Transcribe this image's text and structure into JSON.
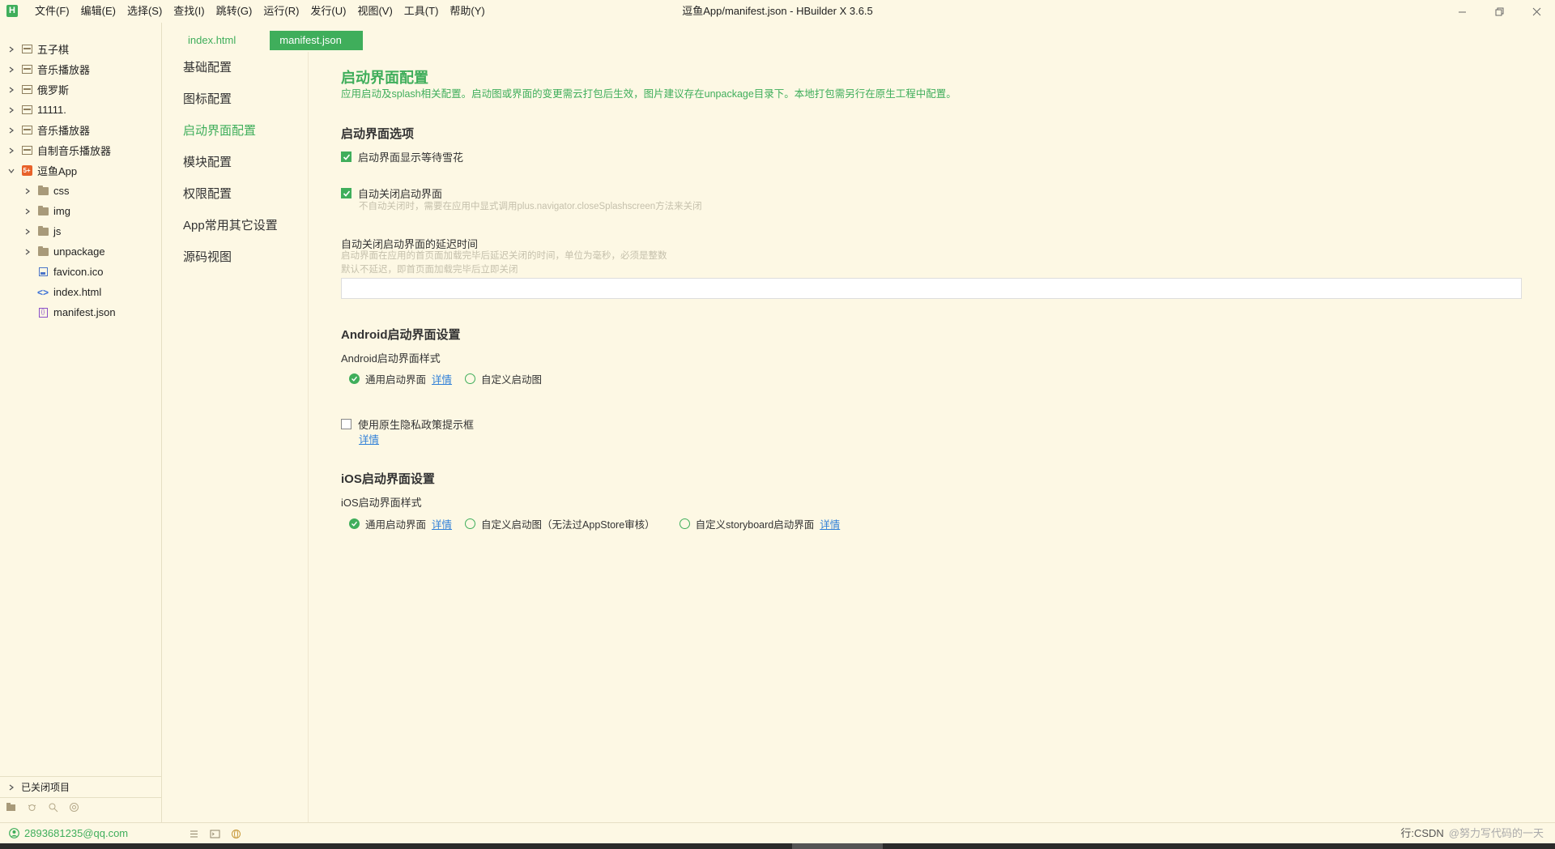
{
  "app": {
    "logo": "H",
    "title": "逗鱼App/manifest.json - HBuilder X 3.6.5",
    "menu": [
      "文件(F)",
      "编辑(E)",
      "选择(S)",
      "查找(I)",
      "跳转(G)",
      "运行(R)",
      "发行(U)",
      "视图(V)",
      "工具(T)",
      "帮助(Y)"
    ]
  },
  "tree": {
    "items": [
      {
        "label": "五子棋",
        "type": "project",
        "expanded": false,
        "level": 0
      },
      {
        "label": "音乐播放器",
        "type": "project",
        "expanded": false,
        "level": 0
      },
      {
        "label": "俄罗斯",
        "type": "project",
        "expanded": false,
        "level": 0
      },
      {
        "label": "11111.",
        "type": "project",
        "expanded": false,
        "level": 0
      },
      {
        "label": "音乐播放器",
        "type": "project",
        "expanded": false,
        "level": 0
      },
      {
        "label": "自制音乐播放器",
        "type": "project",
        "expanded": false,
        "level": 0
      },
      {
        "label": "逗鱼App",
        "type": "uniapp",
        "expanded": true,
        "level": 0
      },
      {
        "label": "css",
        "type": "folder",
        "expanded": false,
        "level": 1
      },
      {
        "label": "img",
        "type": "folder",
        "expanded": false,
        "level": 1
      },
      {
        "label": "js",
        "type": "folder",
        "expanded": false,
        "level": 1
      },
      {
        "label": "unpackage",
        "type": "folder",
        "expanded": false,
        "level": 1
      },
      {
        "label": "favicon.ico",
        "type": "ico",
        "level": 1
      },
      {
        "label": "index.html",
        "type": "html",
        "level": 1
      },
      {
        "label": "manifest.json",
        "type": "json",
        "level": 1
      }
    ],
    "closed_projects": "已关闭项目"
  },
  "tabs": [
    "index.html",
    "manifest.json"
  ],
  "nav": [
    "基础配置",
    "图标配置",
    "启动界面配置",
    "模块配置",
    "权限配置",
    "App常用其它设置",
    "源码视图"
  ],
  "nav_active": 2,
  "content": {
    "title": "启动界面配置",
    "desc": "应用启动及splash相关配置。启动图或界面的变更需云打包后生效，图片建议存在unpackage目录下。本地打包需另行在原生工程中配置。",
    "options_title": "启动界面选项",
    "cb_waiting": "启动界面显示等待雪花",
    "cb_autoclose": "自动关闭启动界面",
    "cb_autoclose_hint": "不自动关闭时，需要在应用中显式调用plus.navigator.closeSplashscreen方法来关闭",
    "delay_label": "自动关闭启动界面的延迟时间",
    "delay_hint1": "启动界面在应用的首页面加载完毕后延迟关闭的时间，单位为毫秒，必须是整数",
    "delay_hint2": "默认不延迟，即首页面加载完毕后立即关闭",
    "delay_value": "",
    "android_title": "Android启动界面设置",
    "android_style": "Android启动界面样式",
    "android_opt1": "通用启动界面",
    "android_opt2": "自定义启动图",
    "detail": "详情",
    "privacy_label": "使用原生隐私政策提示框",
    "ios_title": "iOS启动界面设置",
    "ios_style": "iOS启动界面样式",
    "ios_opt1": "通用启动界面",
    "ios_opt2": "自定义启动图（无法过AppStore审核）",
    "ios_opt3": "自定义storyboard启动界面"
  },
  "status": {
    "account": "2893681235@qq.com",
    "right": "行:CSDN",
    "watermark": "@努力写代码的一天"
  },
  "colors": {
    "accent": "#3fae5b",
    "background": "#fdf8e4",
    "link": "#2f7fd8"
  }
}
